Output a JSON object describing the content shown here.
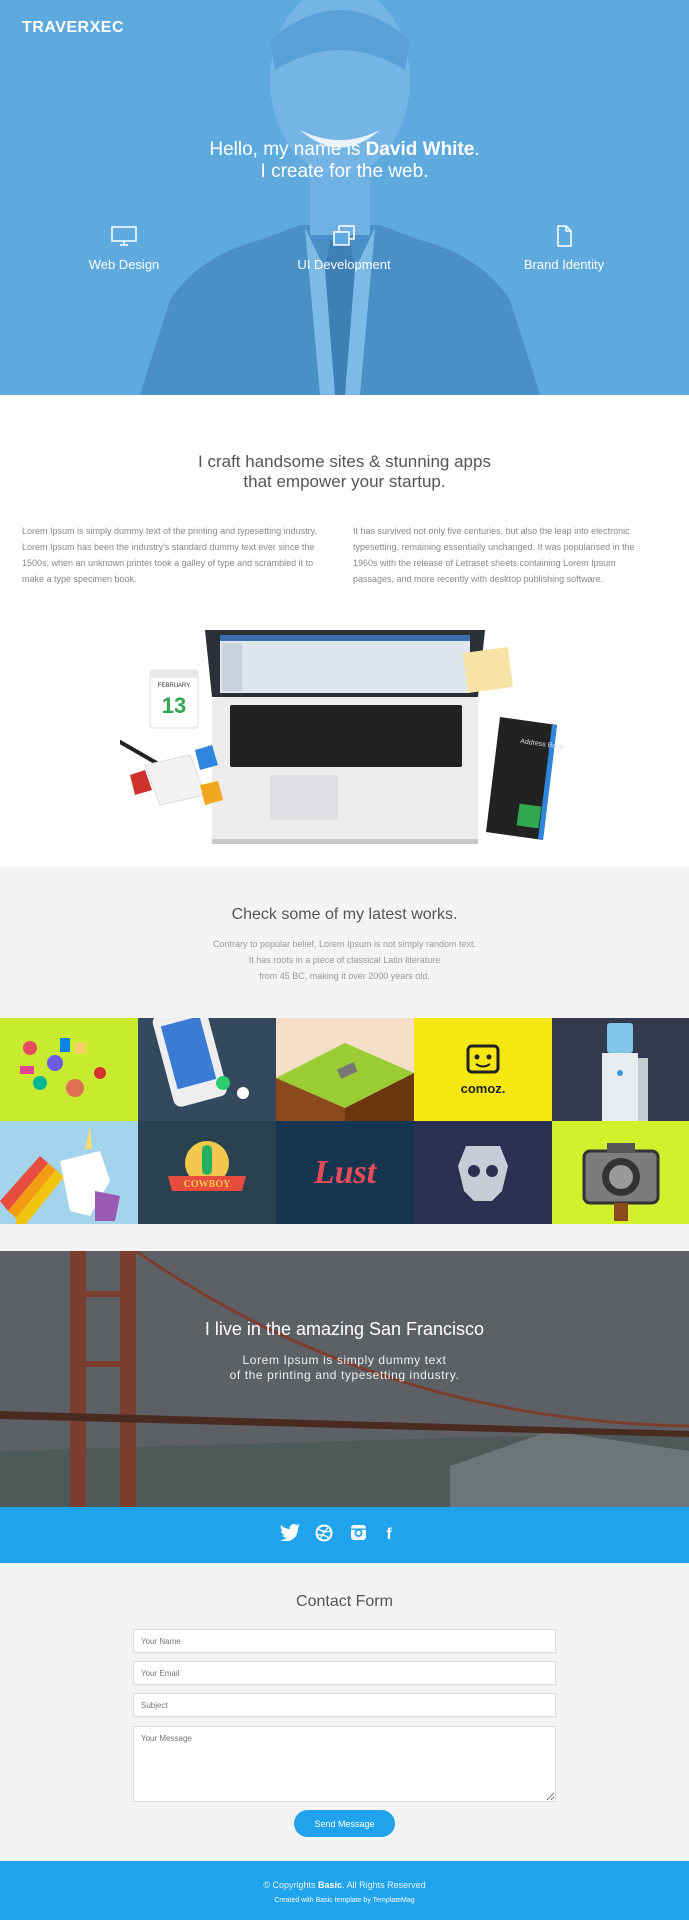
{
  "hero": {
    "brand": "TRAVERXEC",
    "greeting_pre": "Hello, my name is ",
    "greeting_name": "David White",
    "greeting_post": ".",
    "tagline": "I create for the web.",
    "services": [
      {
        "label": "Web Design",
        "icon": "monitor-icon"
      },
      {
        "label": "UI Development",
        "icon": "windows-icon"
      },
      {
        "label": "Brand Identity",
        "icon": "document-icon"
      }
    ]
  },
  "about": {
    "heading_line1": "I craft handsome sites & stunning apps",
    "heading_line2": "that empower your startup.",
    "col1": "Lorem Ipsum is simply dummy text of the printing and typesetting industry. Lorem Ipsum has been the industry's standard dummy text ever since the 1500s, when an unknown printer took a galley of type and scrambled it to make a type specimen book.",
    "col2": "It has survived not only five centuries, but also the leap into electronic typesetting, remaining essentially unchanged. It was popularised in the 1960s with the release of Letraset sheets containing Lorem Ipsum passages, and more recently with desktop publishing software.",
    "calendar_month": "FEBRUARY",
    "calendar_day": "13",
    "notebook_label": "Address Book"
  },
  "works": {
    "heading": "Check some of my latest works.",
    "desc_line1": "Contrary to popular belief, Lorem Ipsum is not simply random text.",
    "desc_line2": "It has roots in a piece of classical Latin literature",
    "desc_line3": "from 45 BC, making it over 2000 years old.",
    "tiles": [
      {
        "name": "sweets",
        "color": "#c8ea2f"
      },
      {
        "name": "phone-apps",
        "color": "#34495e"
      },
      {
        "name": "isometric-hill",
        "color": "#b5dd3f"
      },
      {
        "name": "comoz",
        "color": "#f5e711",
        "text": "comoz."
      },
      {
        "name": "water-cooler",
        "color": "#333a4d"
      },
      {
        "name": "unicorn",
        "color": "#a4d3ec"
      },
      {
        "name": "cowboy-culture",
        "color": "#2a4250",
        "text": "COWBOY"
      },
      {
        "name": "lust",
        "color": "#163550",
        "text": "Lust"
      },
      {
        "name": "skull",
        "color": "#2c3052"
      },
      {
        "name": "camera",
        "color": "#d2f02c"
      }
    ]
  },
  "city": {
    "heading": "I live in the amazing San Francisco",
    "sub_line1": "Lorem Ipsum is simply dummy text",
    "sub_line2": "of the printing and typesetting industry."
  },
  "social": [
    {
      "name": "twitter-icon"
    },
    {
      "name": "dribbble-icon"
    },
    {
      "name": "instagram-icon"
    },
    {
      "name": "facebook-icon",
      "glyph": "f"
    }
  ],
  "contact": {
    "heading": "Contact Form",
    "name_placeholder": "Your Name",
    "email_placeholder": "Your Email",
    "subject_placeholder": "Subject",
    "message_placeholder": "Your Message",
    "send_label": "Send Message"
  },
  "footer": {
    "copyright_pre": "© Copyrights ",
    "copyright_brand": "Basic",
    "copyright_post": ". All Rights Reserved",
    "credit": "Created with Basic template by TemplateMag"
  }
}
